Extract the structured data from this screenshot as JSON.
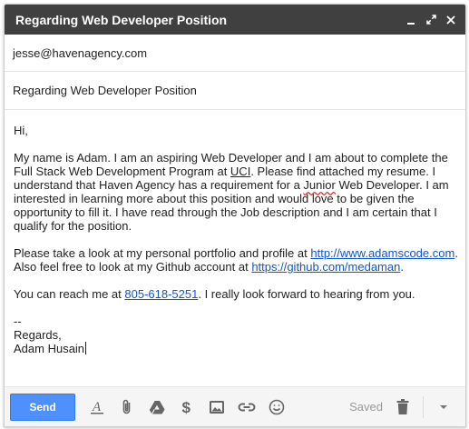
{
  "window": {
    "title": "Regarding Web Developer Position"
  },
  "compose": {
    "to": "jesse@havenagency.com",
    "subject": "Regarding Web Developer Position"
  },
  "message": {
    "greeting": "Hi,",
    "p1_a": "My name is Adam. I am an aspiring Web Developer and I am about to complete the Full Stack Web Development Program at ",
    "p1_uci": "UCI",
    "p1_b": ". Please find attached my resume. I understand that Haven Agency has a requirement for a ",
    "p1_junior": "Junior",
    "p1_c": " Web Developer. I am interested in learning more about this position and would love to be given the opportunity to fill it. I have read through the Job description and I am certain that I qualify for the position.",
    "p2_a": "Please take a look at my personal portfolio and profile at ",
    "portfolio_link": "http://www.adamscode.com",
    "p2_b": ".",
    "p2_c": "Also feel free to look at my Github account at ",
    "github_link": "https://github.com/medaman",
    "p2_d": ".",
    "p3_a": "You can reach me at ",
    "phone_link": "805-618-5251",
    "p3_b": ". I really look forward to hearing from you.",
    "sig_dash": "--",
    "sig_regards": "Regards,",
    "sig_name": "Adam Husain"
  },
  "toolbar": {
    "send_label": "Send",
    "saved_label": "Saved",
    "icons": [
      "text-format-icon",
      "attach-icon",
      "drive-icon",
      "money-icon",
      "photo-icon",
      "link-icon",
      "emoji-icon",
      "trash-icon",
      "more-options-icon"
    ]
  },
  "colors": {
    "titlebar": "#404040",
    "send": "#4d90fe",
    "link": "#1155cc"
  }
}
